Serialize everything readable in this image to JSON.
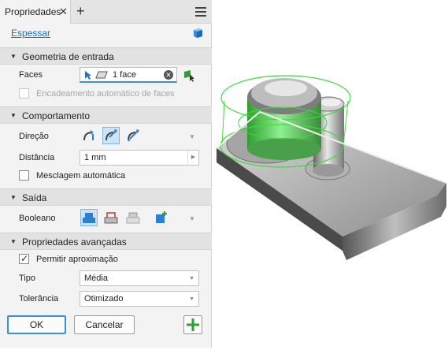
{
  "tab": {
    "label": "Propriedades"
  },
  "link": "Espessar",
  "sections": {
    "input": "Geometria de entrada",
    "behavior": "Comportamento",
    "output": "Saída",
    "advanced": "Propriedades avançadas"
  },
  "input_geometry": {
    "faces_label": "Faces",
    "faces_value": "1 face",
    "auto_chain_label": "Encadeamento automático de faces"
  },
  "behavior": {
    "direction_label": "Direção",
    "distance_label": "Distância",
    "distance_value": "1 mm",
    "auto_blend_label": "Mesclagem automática"
  },
  "output": {
    "boolean_label": "Booleano"
  },
  "advanced": {
    "allow_approx_label": "Permitir aproximação",
    "type_label": "Tipo",
    "type_value": "Média",
    "tolerance_label": "Tolerância",
    "tolerance_value": "Otimizado"
  },
  "buttons": {
    "ok": "OK",
    "cancel": "Cancelar"
  },
  "colors": {
    "accent": "#3d8fd8",
    "selection_green": "#3fd93f",
    "link": "#1f6fbf"
  }
}
